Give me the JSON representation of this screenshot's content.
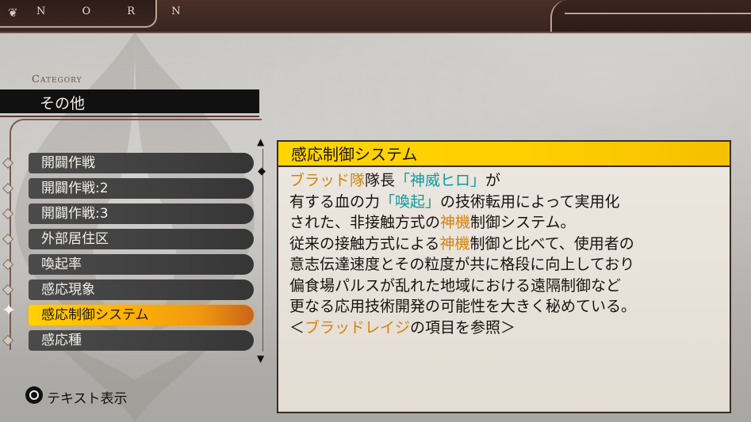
{
  "header": {
    "logo_text": "N O R N",
    "logo_icon": "fleur-icon"
  },
  "category": {
    "label": "Category",
    "value": "その他"
  },
  "sidebar": {
    "items": [
      {
        "label": "開闢作戦"
      },
      {
        "label": "開闢作戦:2"
      },
      {
        "label": "開闢作戦:3"
      },
      {
        "label": "外部居住区"
      },
      {
        "label": "喚起率"
      },
      {
        "label": "感応現象"
      },
      {
        "label": "感応制御システム",
        "selected": true
      },
      {
        "label": "感応種"
      }
    ]
  },
  "detail": {
    "title": "感応制御システム",
    "line1": {
      "a": "ブラッド隊",
      "b": "隊長",
      "c": "「神威ヒロ」",
      "d": "が"
    },
    "line2": {
      "a": "有する血の力",
      "b": "「喚起」",
      "c": "の技術転用によって実用化"
    },
    "line3": {
      "a": "された、非接触方式の",
      "b": "神機",
      "c": "制御システム。"
    },
    "line4": {
      "a": "従来の接触方式による",
      "b": "神機",
      "c": "制御と比べて、使用者の"
    },
    "line5": "意志伝達速度とその粒度が共に格段に向上しており",
    "line6": "偏食場パルスが乱れた地域における遠隔制御など",
    "line7": "更なる応用技術開発の可能性を大きく秘めている。",
    "line8": {
      "a": "＜",
      "b": "ブラッドレイジ",
      "c": "の項目を参照＞"
    }
  },
  "footer": {
    "button_label": "テキスト表示"
  },
  "colors": {
    "highlight_orange": "#d6820a",
    "highlight_teal": "#0d9aa0",
    "title_bar": "#ffd400",
    "selected_item": "#ffb400"
  }
}
